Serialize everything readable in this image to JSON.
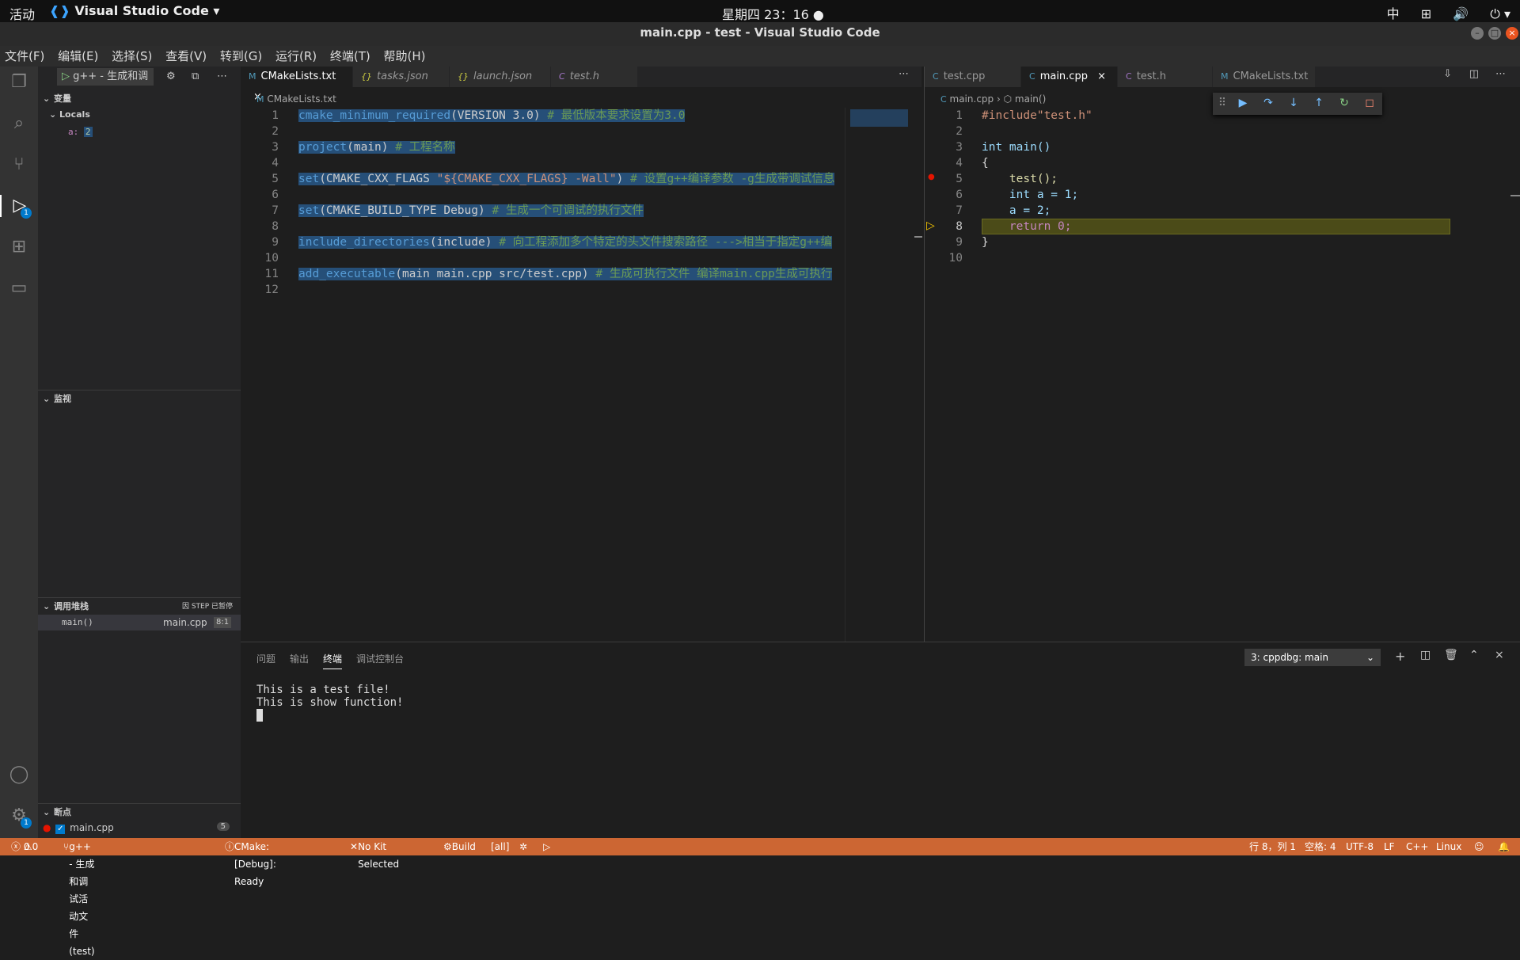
{
  "system": {
    "activities": "活动",
    "app_name": "Visual Studio Code",
    "clock": "星期四 23：16",
    "input_method": "中"
  },
  "window": {
    "title": "main.cpp - test - Visual Studio Code"
  },
  "menu": [
    "文件(F)",
    "编辑(E)",
    "选择(S)",
    "查看(V)",
    "转到(G)",
    "运行(R)",
    "终端(T)",
    "帮助(H)"
  ],
  "debug": {
    "config": "g++ - 生成和调"
  },
  "variables": {
    "header": "变量",
    "locals": "Locals",
    "var_name": "a:",
    "var_value": "2"
  },
  "watch": {
    "header": "监视"
  },
  "callstack": {
    "header": "调用堆栈",
    "status": "因 STEP 已暂停",
    "frame": "main()",
    "file": "main.cpp",
    "pos": "8:1"
  },
  "breakpoints": {
    "header": "断点",
    "file": "main.cpp",
    "line": "5"
  },
  "left_editor": {
    "tabs": [
      "CMakeLists.txt",
      "tasks.json",
      "launch.json",
      "test.h"
    ],
    "breadcrumb": "CMakeLists.txt",
    "lines": [
      "1",
      "2",
      "3",
      "4",
      "5",
      "6",
      "7",
      "8",
      "9",
      "10",
      "11",
      "12"
    ],
    "code": [
      {
        "fn": "cmake_minimum_required",
        "rest": "(VERSION 3.0) ",
        "cm": "# 最低版本要求设置为3.0"
      },
      {
        "fn": "",
        "rest": "",
        "cm": ""
      },
      {
        "fn": "project",
        "rest": "(main) ",
        "cm": "# 工程名称"
      },
      {
        "fn": "",
        "rest": "",
        "cm": ""
      },
      {
        "fn": "set",
        "rest": "(CMAKE_CXX_FLAGS ",
        "st": "\"${CMAKE_CXX_FLAGS} -Wall\"",
        "rest2": ") ",
        "cm": "# 设置g++编译参数 -g生成带调试信息"
      },
      {
        "fn": "",
        "rest": "",
        "cm": ""
      },
      {
        "fn": "set",
        "rest": "(CMAKE_BUILD_TYPE Debug) ",
        "cm": "# 生成一个可调试的执行文件"
      },
      {
        "fn": "",
        "rest": "",
        "cm": ""
      },
      {
        "fn": "include_directories",
        "rest": "(include) ",
        "cm": "# 向工程添加多个特定的头文件搜索路径 --->相当于指定g++编"
      },
      {
        "fn": "",
        "rest": "",
        "cm": ""
      },
      {
        "fn": "add_executable",
        "rest": "(main main.cpp src/test.cpp) ",
        "cm": "# 生成可执行文件 编译main.cpp生成可执行"
      },
      {
        "fn": "",
        "rest": "",
        "cm": ""
      }
    ]
  },
  "right_editor": {
    "tabs": [
      "test.cpp",
      "main.cpp",
      "test.h",
      "CMakeLists.txt"
    ],
    "breadcrumb_file": "main.cpp",
    "breadcrumb_symbol": "main()",
    "lines": [
      "1",
      "2",
      "3",
      "4",
      "5",
      "6",
      "7",
      "8",
      "9",
      "10"
    ],
    "code": [
      "#include\"test.h\"",
      "",
      "int main()",
      "{",
      "    test();",
      "    int a = 1;",
      "    a = 2;",
      "    return 0;",
      "}",
      ""
    ]
  },
  "panel": {
    "tabs": [
      "问题",
      "输出",
      "终端",
      "调试控制台"
    ],
    "terminal_select": "3: cppdbg: main",
    "terminal_lines": [
      "This is a test file!",
      "This is show function!"
    ]
  },
  "statusbar": {
    "errors": "0",
    "warnings": "0",
    "launch": "g++ - 生成和调试活动文件 (test)",
    "cmake": "CMake: [Debug]: Ready",
    "kit": "No Kit Selected",
    "build": "Build",
    "target": "[all]",
    "position": "行 8，列 1",
    "spaces": "空格: 4",
    "encoding": "UTF-8",
    "eol": "LF",
    "language": "C++",
    "os": "Linux"
  },
  "colors": {
    "statusbar": "#cc6633",
    "accent": "#007acc",
    "current_line": "#4b4b18"
  }
}
